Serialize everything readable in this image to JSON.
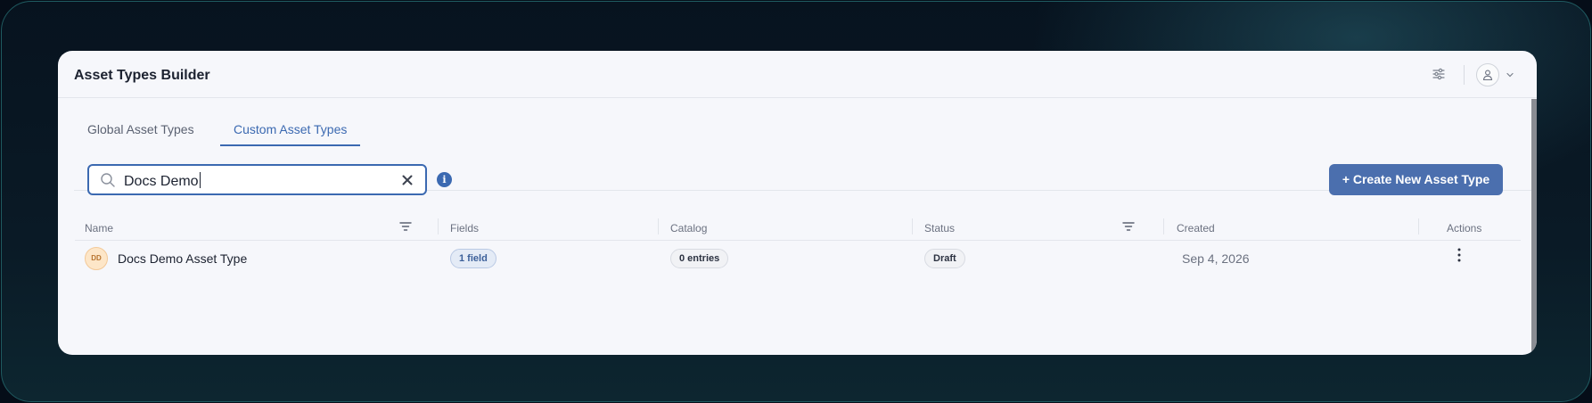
{
  "app": {
    "title": "Asset Types Builder"
  },
  "header": {
    "settings_icon": "sliders-icon",
    "avatar_icon": "user-icon",
    "avatar_menu_icon": "chevron-down-icon"
  },
  "tabs": [
    {
      "label": "Global Asset Types",
      "active": false
    },
    {
      "label": "Custom Asset Types",
      "active": true
    }
  ],
  "search": {
    "value": "Docs Demo",
    "placeholder": "",
    "search_icon": "search-icon",
    "clear_icon": "close-icon",
    "info_label": "i"
  },
  "create_button": {
    "label": "+ Create New Asset Type"
  },
  "table": {
    "columns": [
      "Name",
      "Fields",
      "Catalog",
      "Status",
      "Created",
      "Actions"
    ],
    "rows": [
      {
        "initials": "DD",
        "name": "Docs Demo Asset Type",
        "fields": "1 field",
        "catalog": "0 entries",
        "status": "Draft",
        "created": "Sep 4, 2026"
      }
    ]
  },
  "colors": {
    "accent": "#3b69b1",
    "button": "#4b6fae",
    "background": "#050d18",
    "panel": "#f6f7fb"
  }
}
